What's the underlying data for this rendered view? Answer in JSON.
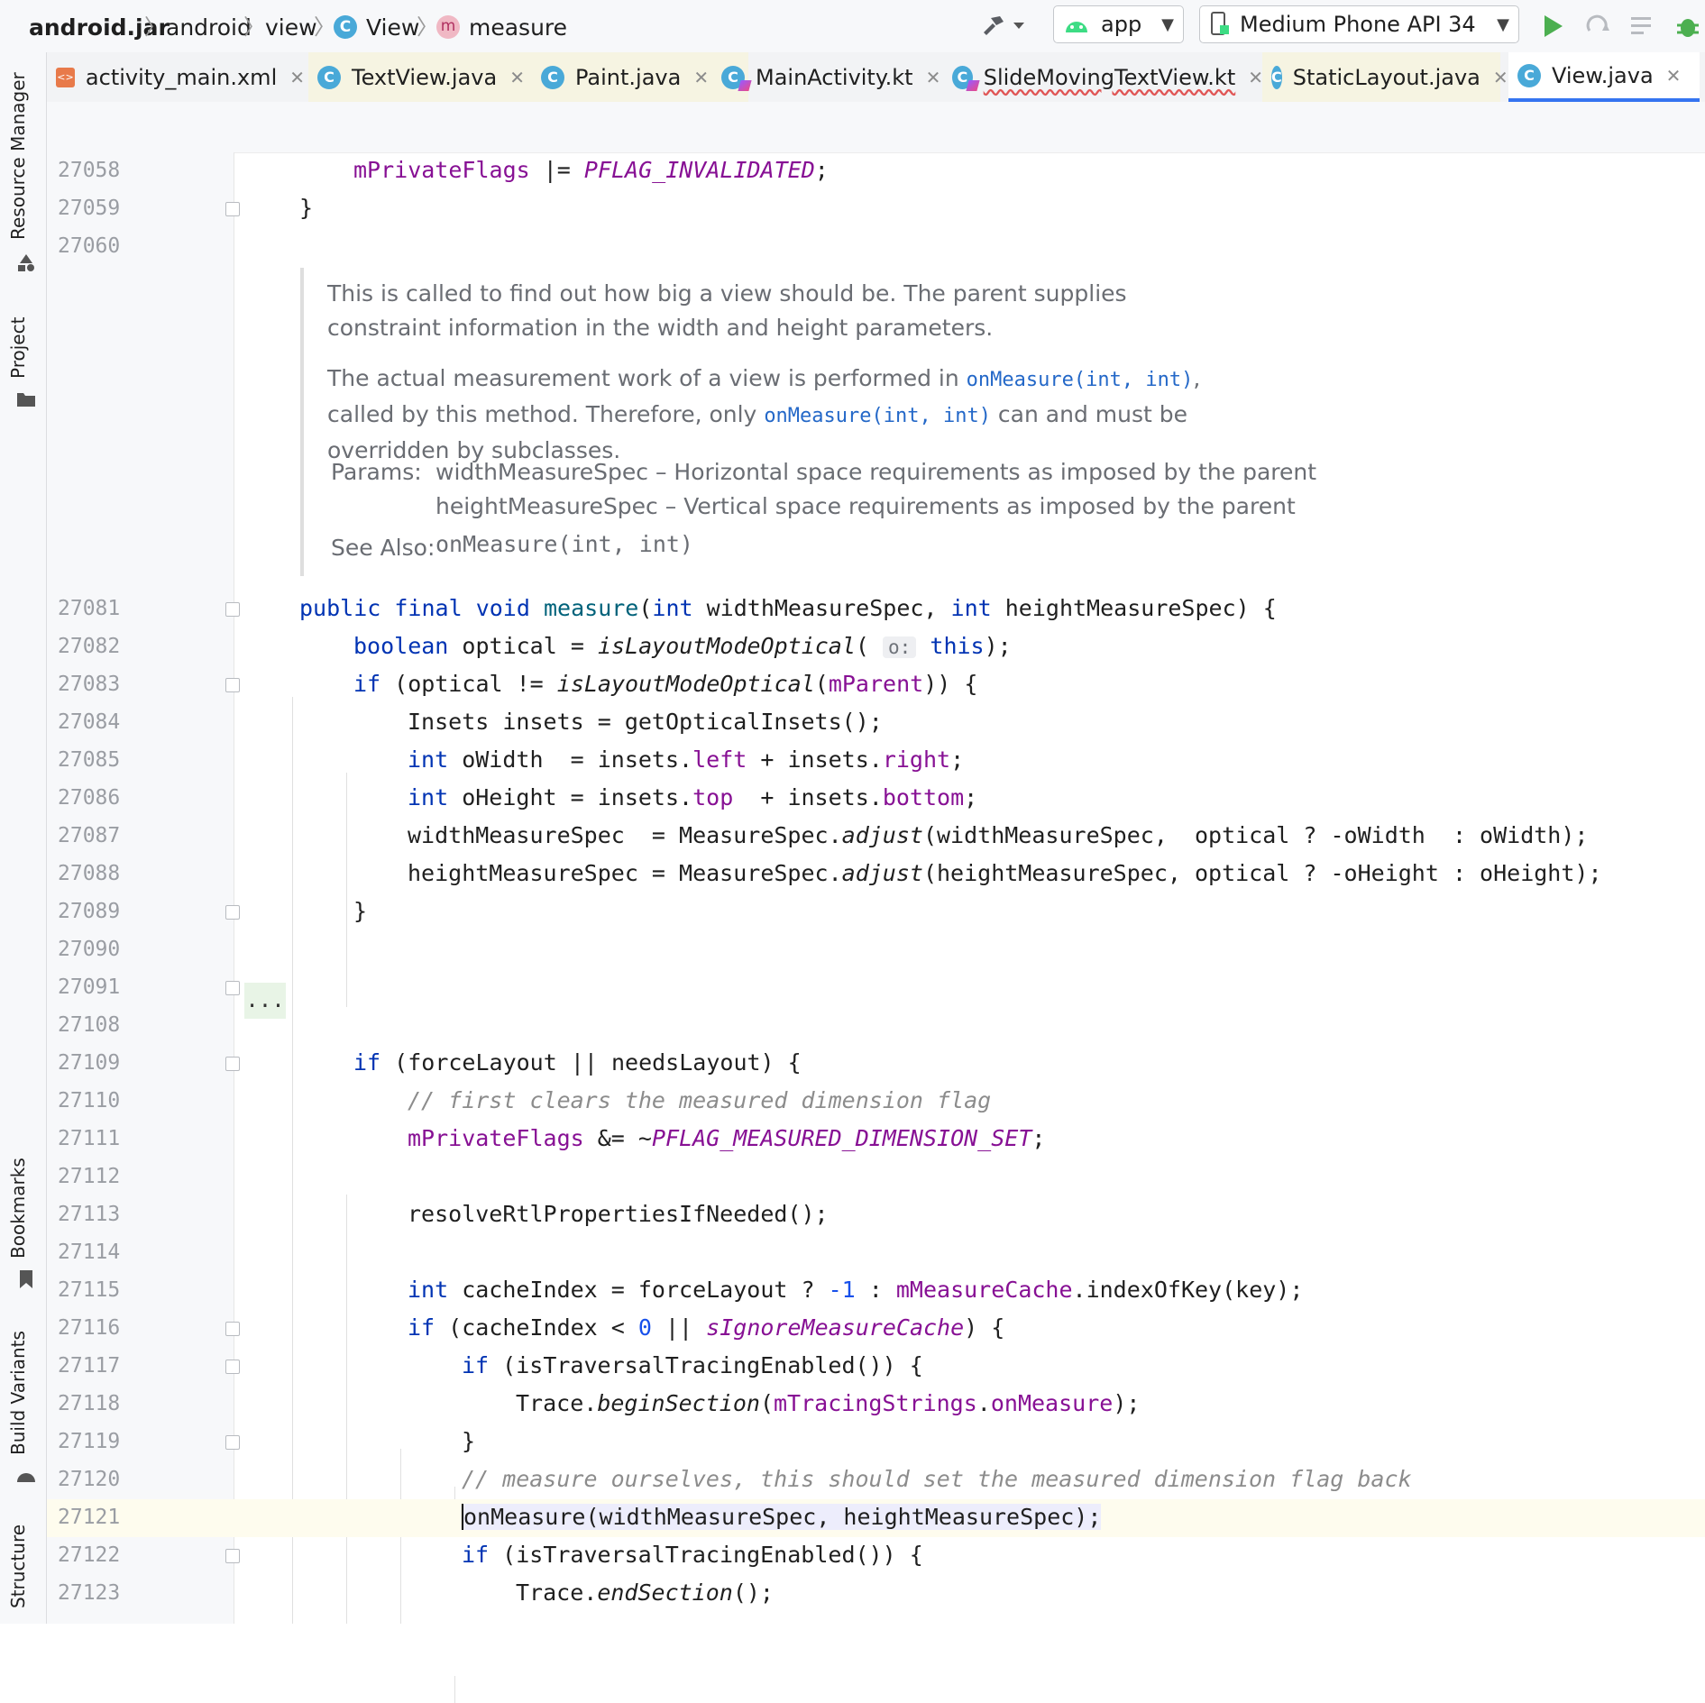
{
  "breadcrumb": {
    "items": [
      {
        "label": "android.jar",
        "bold": true
      },
      {
        "label": "android"
      },
      {
        "label": "view"
      },
      {
        "label": "View",
        "icon": "class-icon"
      },
      {
        "label": "measure",
        "icon": "method-icon"
      }
    ]
  },
  "toolbar": {
    "run_config": "app",
    "device": "Medium Phone API 34"
  },
  "tabs": [
    {
      "label": "activity_main.xml",
      "icon": "xml-file-icon"
    },
    {
      "label": "TextView.java",
      "icon": "class-icon"
    },
    {
      "label": "Paint.java",
      "icon": "class-icon"
    },
    {
      "label": "MainActivity.kt",
      "icon": "kotlin-class-icon"
    },
    {
      "label": "SlideMovingTextView.kt",
      "icon": "kotlin-class-icon"
    },
    {
      "label": "StaticLayout.java",
      "icon": "class-icon"
    },
    {
      "label": "View.java",
      "icon": "class-icon",
      "active": true
    }
  ],
  "left_tools": {
    "resource_manager": "Resource Manager",
    "project": "Project",
    "bookmarks": "Bookmarks",
    "build_variants": "Build Variants",
    "structure": "Structure"
  },
  "doc": {
    "p1": "This is called to find out how big a view should be. The parent supplies constraint information in the width and height parameters.",
    "p2_a": "The actual measurement work of a view is performed in ",
    "p2_link1": "onMeasure(int, int)",
    "p2_b": ", called by this method. Therefore, only ",
    "p2_link2": "onMeasure(int, int)",
    "p2_c": " can and must be overridden by subclasses.",
    "params_label": "Params:",
    "param1": "widthMeasureSpec – Horizontal space requirements as imposed by the parent",
    "param2": "heightMeasureSpec – Vertical space requirements as imposed by the parent",
    "see_also_label": "See Also:",
    "see_also_link": "onMeasure(int, int)"
  },
  "editor": {
    "collapsed_marker": "...",
    "hint_o": "o:",
    "line_numbers": [
      "27058",
      "27059",
      "27060",
      "27081",
      "27082",
      "27083",
      "27084",
      "27085",
      "27086",
      "27087",
      "27088",
      "27089",
      "27090",
      "27091",
      "27108",
      "27109",
      "27110",
      "27111",
      "27112",
      "27113",
      "27114",
      "27115",
      "27116",
      "27117",
      "27118",
      "27119",
      "27120",
      "27121",
      "27122",
      "27123"
    ],
    "code": {
      "l27058": [
        "mPrivateFlags",
        " |= ",
        "PFLAG_INVALIDATED",
        ";"
      ],
      "l27059": "}",
      "l27081": [
        "public",
        " ",
        "final",
        " ",
        "void",
        " ",
        "measure",
        "(",
        "int",
        " widthMeasureSpec, ",
        "int",
        " heightMeasureSpec) {"
      ],
      "l27082": [
        "boolean",
        " optical = ",
        "isLayoutModeOptical",
        "( ",
        " ",
        "this",
        ");"
      ],
      "l27083": [
        "if",
        " (optical != ",
        "isLayoutModeOptical",
        "(",
        "mParent",
        ")) {"
      ],
      "l27084": "Insets insets = getOpticalInsets();",
      "l27085": [
        "int",
        " oWidth  = insets.",
        "left",
        " + insets.",
        "right",
        ";"
      ],
      "l27086": [
        "int",
        " oHeight = insets.",
        "top",
        "  + insets.",
        "bottom",
        ";"
      ],
      "l27087": [
        "widthMeasureSpec  = MeasureSpec.",
        "adjust",
        "(widthMeasureSpec,  optical ? -oWidth  : oWidth);"
      ],
      "l27088": [
        "heightMeasureSpec = MeasureSpec.",
        "adjust",
        "(heightMeasureSpec, optical ? -oHeight : oHeight);"
      ],
      "l27089": "}",
      "l27109": [
        "if",
        " (forceLayout || needsLayout) {"
      ],
      "l27110": "// first clears the measured dimension flag",
      "l27111": [
        "mPrivateFlags",
        " &= ~",
        "PFLAG_MEASURED_DIMENSION_SET",
        ";"
      ],
      "l27113": "resolveRtlPropertiesIfNeeded();",
      "l27115": [
        "int",
        " cacheIndex = forceLayout ? ",
        "-1",
        " : ",
        "mMeasureCache",
        ".indexOfKey(key);"
      ],
      "l27116": [
        "if",
        " (cacheIndex < ",
        "0",
        " || ",
        "sIgnoreMeasureCache",
        ") {"
      ],
      "l27117": [
        "if",
        " (isTraversalTracingEnabled()) {"
      ],
      "l27118": [
        "Trace.",
        "beginSection",
        "(",
        "mTracingStrings",
        ".",
        "onMeasure",
        ");"
      ],
      "l27119": "}",
      "l27120": "// measure ourselves, this should set the measured dimension flag back",
      "l27121": "onMeasure(widthMeasureSpec, heightMeasureSpec);",
      "l27122": [
        "if",
        " (isTraversalTracingEnabled()) {"
      ],
      "l27123": [
        "Trace.",
        "endSection",
        "();"
      ]
    }
  },
  "colors": {
    "keyword": "#0033b3",
    "field": "#871094",
    "comment": "#8c8c8c",
    "number": "#1750eb",
    "accent": "#3574f0",
    "run_green": "#4caf50"
  }
}
